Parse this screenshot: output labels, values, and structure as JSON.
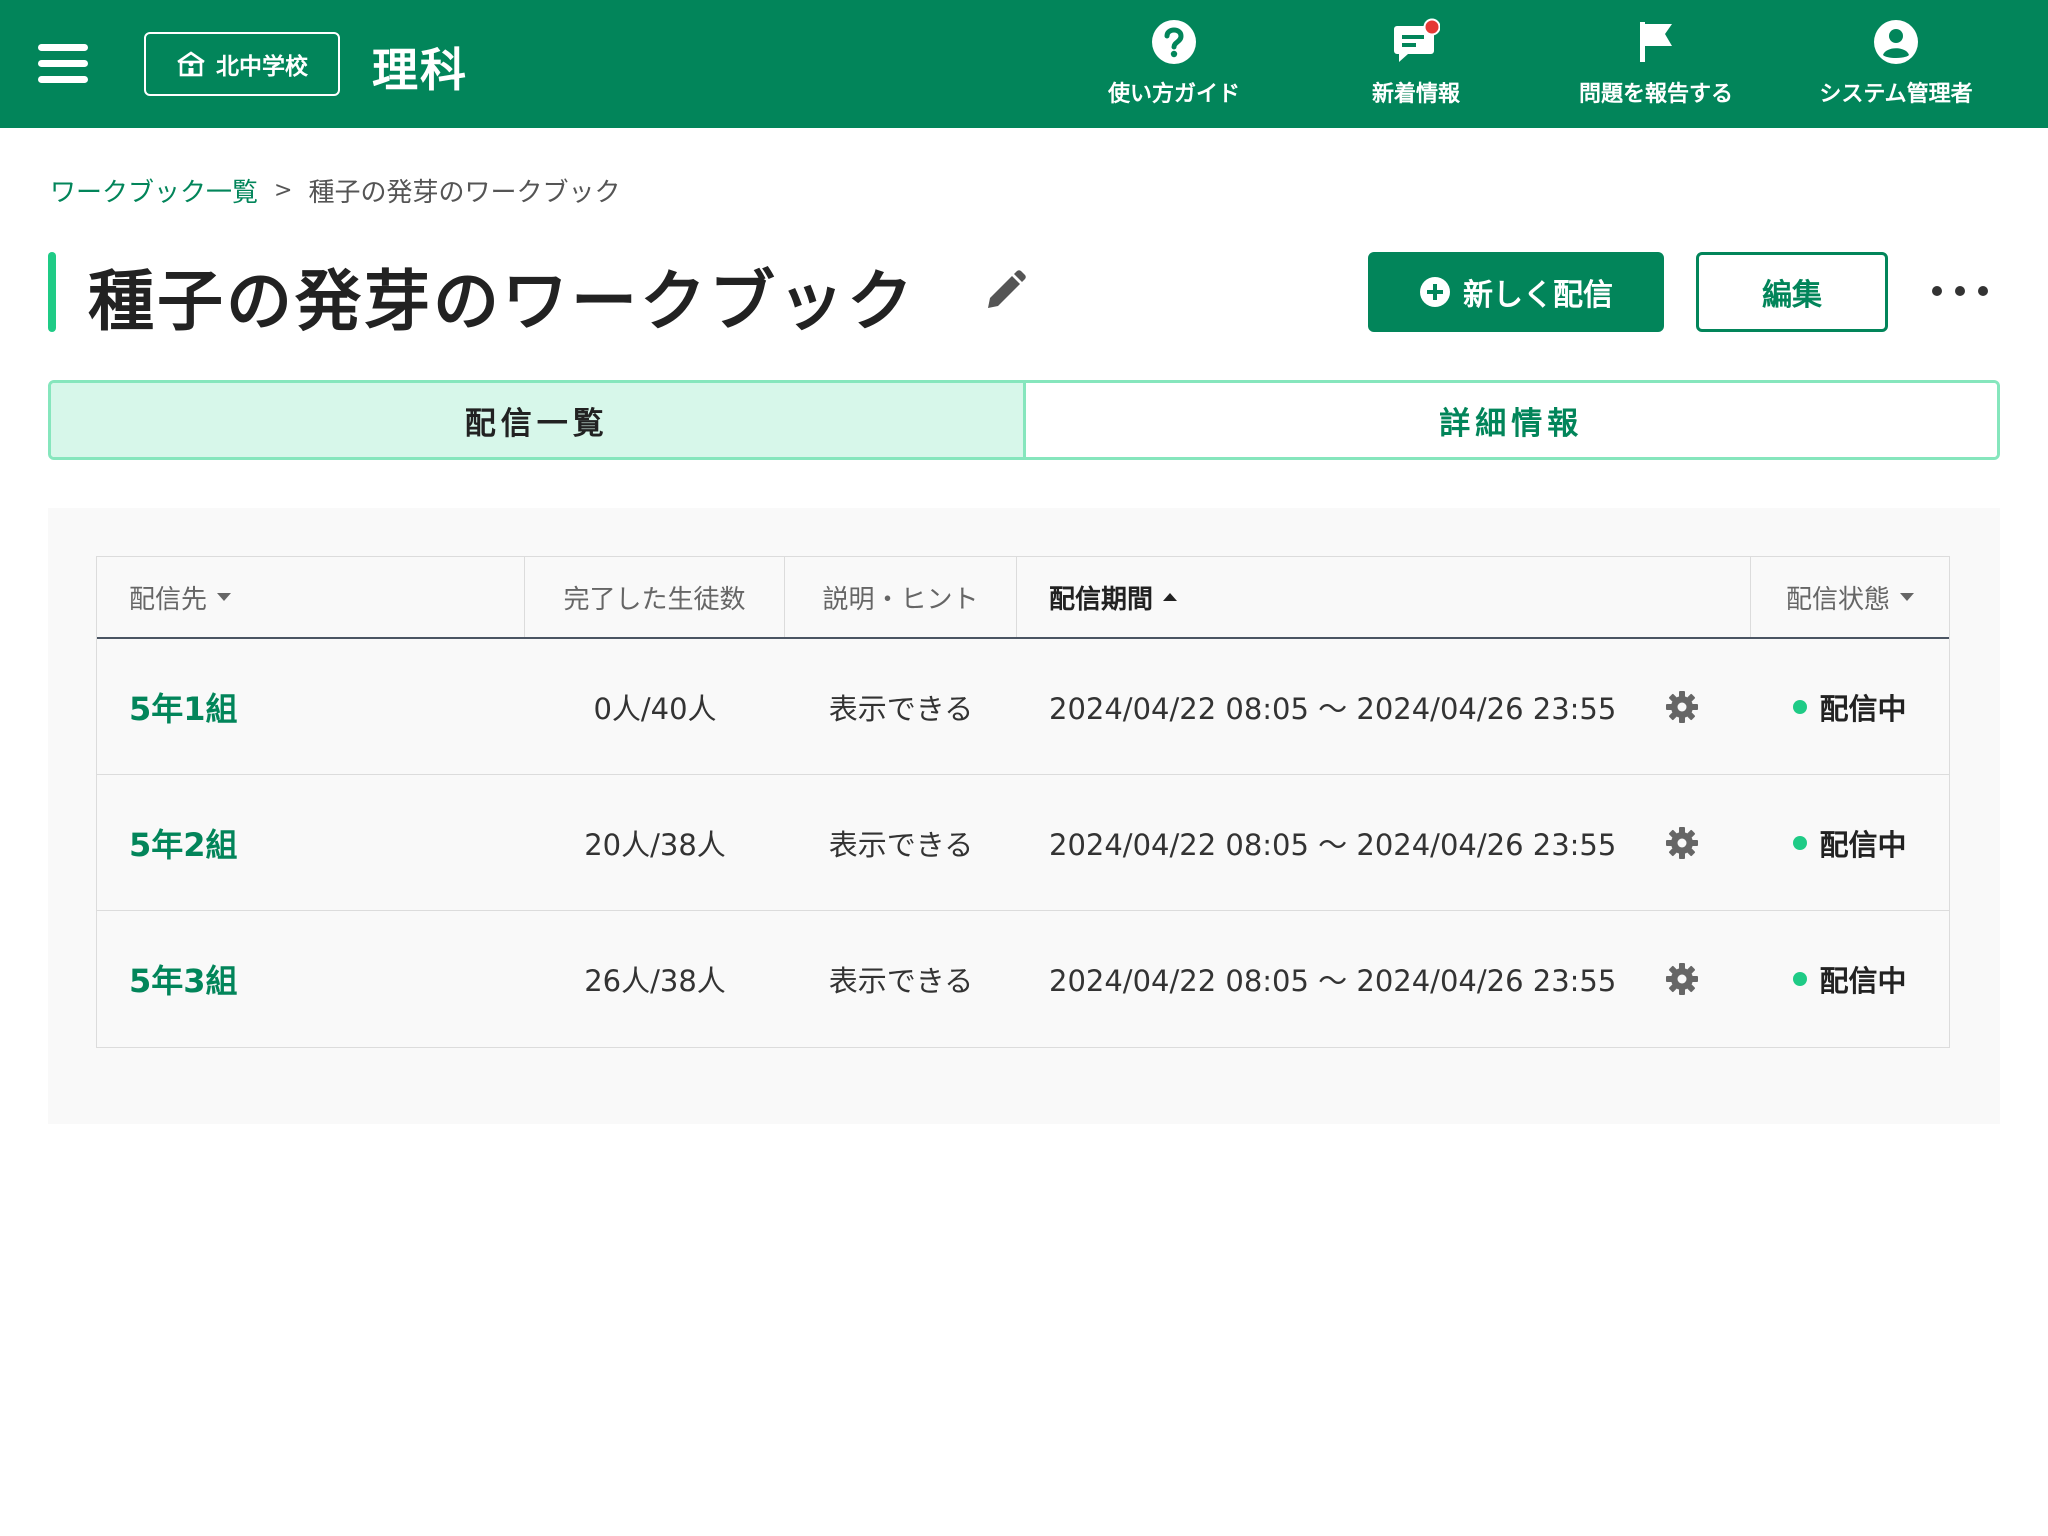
{
  "header": {
    "school_label": "北中学校",
    "subject": "理科",
    "nav": [
      {
        "label": "使い方ガイド",
        "icon": "help-icon"
      },
      {
        "label": "新着情報",
        "icon": "news-icon"
      },
      {
        "label": "問題を報告する",
        "icon": "flag-icon"
      },
      {
        "label": "システム管理者",
        "icon": "account-icon"
      }
    ],
    "notification_color": "#e53935"
  },
  "breadcrumb": {
    "parent": "ワークブック一覧",
    "separator": ">",
    "current": "種子の発芽のワークブック"
  },
  "page": {
    "title": "種子の発芽のワークブック",
    "new_button": "新しく配信",
    "edit_button": "編集"
  },
  "tabs": [
    {
      "label": "配信一覧",
      "active": true
    },
    {
      "label": "詳細情報",
      "active": false
    }
  ],
  "table": {
    "columns": [
      {
        "label": "配信先",
        "sort": "dropdown"
      },
      {
        "label": "完了した生徒数"
      },
      {
        "label": "説明・ヒント"
      },
      {
        "label": "配信期間",
        "sort": "ascending"
      },
      {
        "label": "配信状態",
        "sort": "dropdown"
      }
    ],
    "rows": [
      {
        "class": "5年1組",
        "completed": "0人/40人",
        "hint": "表示できる",
        "period": "2024/04/22 08:05 〜 2024/04/26 23:55",
        "status": "配信中"
      },
      {
        "class": "5年2組",
        "completed": "20人/38人",
        "hint": "表示できる",
        "period": "2024/04/22 08:05 〜 2024/04/26 23:55",
        "status": "配信中"
      },
      {
        "class": "5年3組",
        "completed": "26人/38人",
        "hint": "表示できる",
        "period": "2024/04/22 08:05 〜 2024/04/26 23:55",
        "status": "配信中"
      }
    ]
  },
  "colors": {
    "brand": "#02855a",
    "accent": "#1fcb86",
    "tab_active_bg": "#d7f7ea",
    "tab_border": "#86e6bd"
  }
}
